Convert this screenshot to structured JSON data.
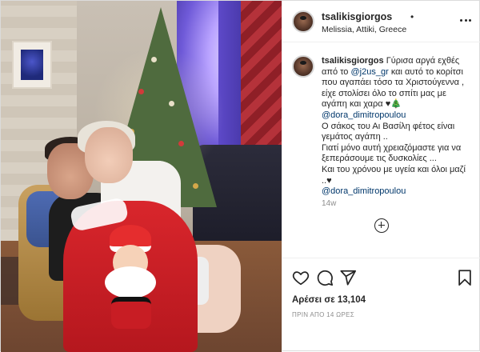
{
  "post": {
    "username": "tsalikisgiorgos",
    "separator": "•",
    "location": "Melissia, Attiki, Greece"
  },
  "caption": {
    "username": "tsalikisgiorgos",
    "line1a": "Γύρισα αργά εχθές από το",
    "mention1": "@j2us_gr",
    "line1b": "και αυτό το κορίτσι που αγαπάει τόσο τα Χριστούγεννα , είχε στολίσει όλο το σπίτι μας με αγάπη και χαρα",
    "emoji1": "♥🎄",
    "mention2": "@dora_dimitropoulou",
    "line2": "Ο σάκος του Αι Βασίλη φέτος είναι γεμάτος αγάπη ..",
    "line3": "Γιατί μόνο αυτή χρειαζόμαστε για να ξεπεράσουμε τις δυσκολίες ...",
    "line4": "Και του χρόνου με υγεία και όλοι μαζί ..",
    "emoji2": "♥",
    "mention3": "@dora_dimitropoulou",
    "time": "14w"
  },
  "stats": {
    "likes": "Αρέσει σε 13,104",
    "posted": "ΠΡΙΝ ΑΠΟ 14 ΩΡΕΣ"
  },
  "icons": {
    "more": "more-options-icon",
    "like": "heart-icon",
    "comment": "comment-icon",
    "share": "share-icon",
    "save": "bookmark-icon",
    "add": "add-comment-icon"
  },
  "colors": {
    "text": "#262626",
    "link": "#00376b",
    "muted": "#8e8e8e",
    "border": "#dbdbdb"
  }
}
